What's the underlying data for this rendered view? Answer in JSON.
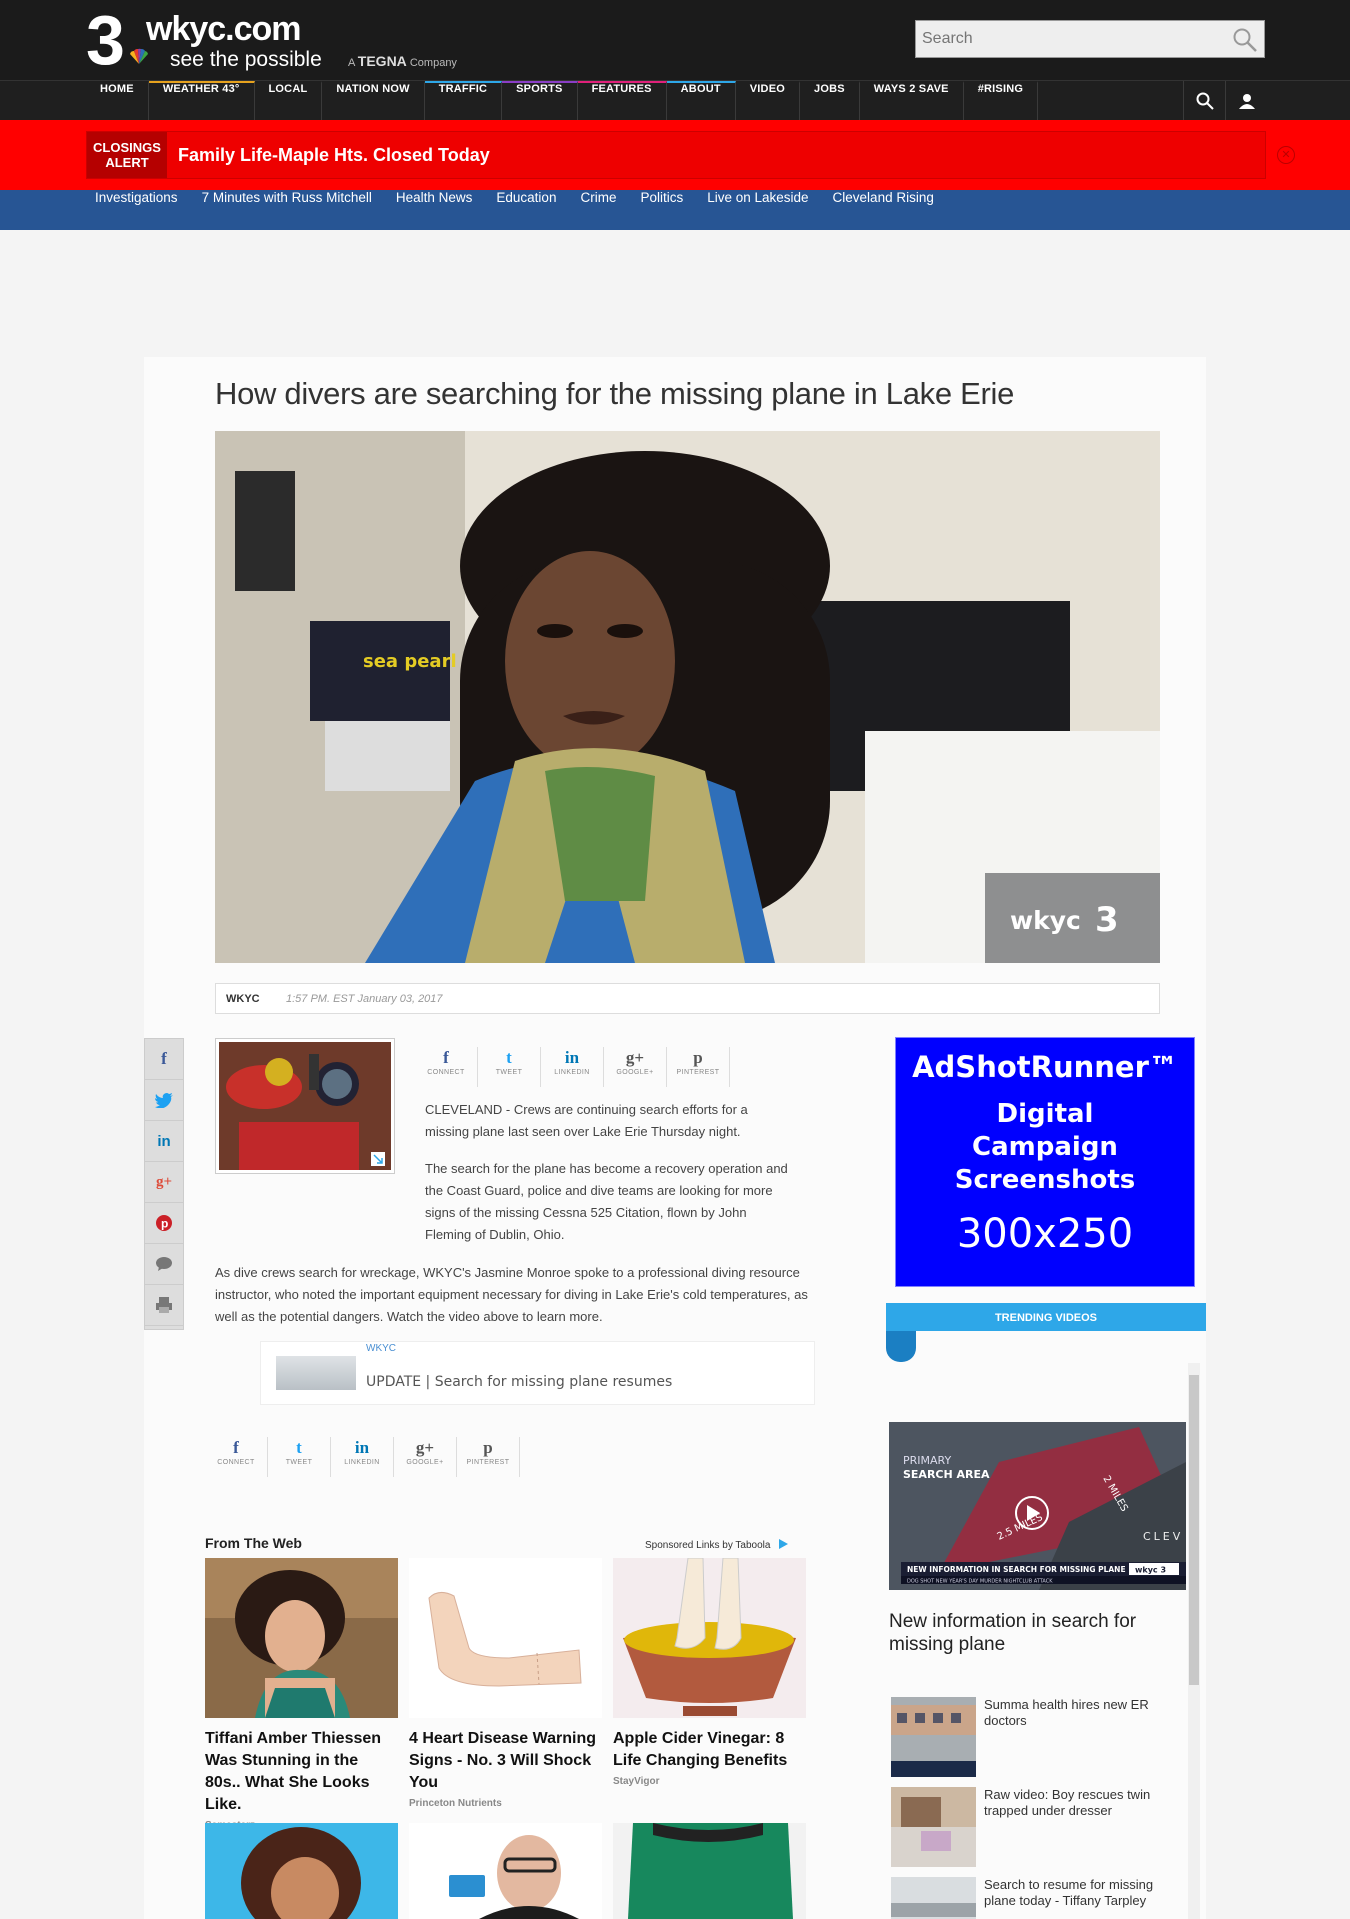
{
  "site": {
    "logo_number": "3",
    "brand": "wkyc.com",
    "tagline": "see the possible",
    "company_prefix": "A",
    "company_name": "TEGNA",
    "company_suffix": "Company"
  },
  "search": {
    "placeholder": "Search"
  },
  "main_nav": {
    "items": [
      {
        "label": "HOME",
        "color": "#ffffff"
      },
      {
        "label": "WEATHER 43°",
        "color": "#e6a21e"
      },
      {
        "label": "LOCAL",
        "color": "#ffffff"
      },
      {
        "label": "NATION NOW",
        "color": "#ffffff"
      },
      {
        "label": "TRAFFIC",
        "color": "#2ea7e8"
      },
      {
        "label": "SPORTS",
        "color": "#8a3ec6"
      },
      {
        "label": "FEATURES",
        "color": "#e0217a"
      },
      {
        "label": "ABOUT",
        "color": "#2ea7e8"
      },
      {
        "label": "VIDEO",
        "color": "#ffffff"
      },
      {
        "label": "JOBS",
        "color": "#ffffff"
      },
      {
        "label": "WAYS 2 SAVE",
        "color": "#ffffff"
      },
      {
        "label": "#RISING",
        "color": "#ffffff"
      }
    ]
  },
  "alert": {
    "label_line1": "CLOSINGS",
    "label_line2": "ALERT",
    "text": "Family Life-Maple Hts. Closed Today"
  },
  "sub_nav": {
    "items": [
      "Investigations",
      "7 Minutes with Russ Mitchell",
      "Health News",
      "Education",
      "Crime",
      "Politics",
      "Live on Lakeside",
      "Cleveland Rising"
    ]
  },
  "article": {
    "headline": "How divers are searching for the missing plane in Lake Erie",
    "video_logo": "wkyc",
    "video_logo_num": "3",
    "video_sign": "sea pearl",
    "source": "WKYC",
    "timestamp": "1:57 PM. EST January 03, 2017",
    "paragraphs": [
      "CLEVELAND - Crews are continuing search efforts for a missing plane last seen over Lake Erie Thursday night.",
      "The search for the plane has become a recovery operation and the Coast Guard, police and dive teams are looking for more signs of the missing Cessna 525 Citation, flown by John Fleming of Dublin, Ohio.",
      "As dive crews search for wreckage, WKYC's Jasmine Monroe spoke to a professional diving resource instructor, who noted the important equipment necessary for diving in Lake Erie's cold temperatures, as well as the potential dangers. Watch the video above to learn more."
    ],
    "share": [
      {
        "glyph": "f",
        "label": "CONNECT",
        "color": "#3b5998"
      },
      {
        "glyph": "t",
        "label": "TWEET",
        "color": "#1da1f2"
      },
      {
        "glyph": "in",
        "label": "LINKEDIN",
        "color": "#0077b5"
      },
      {
        "glyph": "g+",
        "label": "GOOGLE+",
        "color": "#555555"
      },
      {
        "glyph": "p",
        "label": "PINTEREST",
        "color": "#555555"
      }
    ],
    "related": {
      "source": "WKYC",
      "title": "UPDATE | Search for missing plane resumes"
    }
  },
  "from_web": {
    "heading": "From The Web",
    "sponsored": "Sponsored Links by Taboola",
    "cards": [
      {
        "title": "Tiffani Amber Thiessen Was Stunning in the 80s.. What She Looks Like.",
        "source": "Semesterz"
      },
      {
        "title": "4 Heart Disease Warning Signs - No. 3 Will Shock You",
        "source": "Princeton Nutrients"
      },
      {
        "title": "Apple Cider Vinegar: 8 Life Changing Benefits",
        "source": "StayVigor"
      }
    ]
  },
  "ad": {
    "headline": "AdShotRunner™",
    "body_line1": "Digital",
    "body_line2": "Campaign",
    "body_line3": "Screenshots",
    "size": "300x250"
  },
  "trending": {
    "tab_label": "TRENDING VIDEOS",
    "feature_overlay_label_1": "PRIMARY",
    "feature_overlay_label_2": "SEARCH AREA",
    "feature_overlay_miles_1": "2 MILES",
    "feature_overlay_miles_2": "2.5 MILES",
    "feature_overlay_city": "CLEV",
    "feature_ticker": "NEW INFORMATION IN SEARCH FOR MISSING PLANE",
    "feature_ticker_logo": "wkyc 3",
    "feature_ticker_sub": "DOG SHOT     NEW YEAR'S DAY MURDER     NIGHTCLUB ATTACK",
    "feature_title": "New information in search for missing plane",
    "items": [
      {
        "title": "Summa health hires new ER doctors"
      },
      {
        "title": "Raw video: Boy rescues twin trapped under dresser"
      },
      {
        "title": "Search to resume for missing plane today - Tiffany Tarpley"
      }
    ]
  },
  "colors": {
    "alert_red": "#ff0000",
    "subnav_blue": "#275594",
    "ad_blue": "#0000ff",
    "trending_blue": "#2ea7e8"
  }
}
